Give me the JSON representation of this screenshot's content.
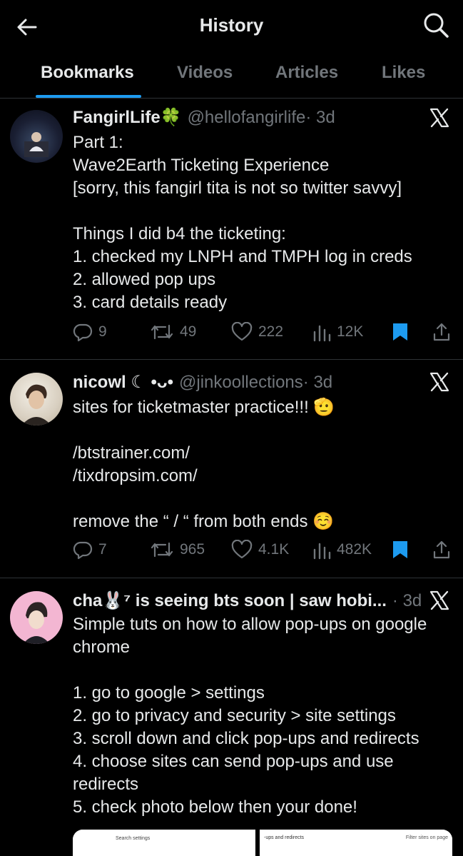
{
  "header": {
    "title": "History"
  },
  "tabs": [
    {
      "label": "Bookmarks",
      "active": true
    },
    {
      "label": "Videos",
      "active": false
    },
    {
      "label": "Articles",
      "active": false
    },
    {
      "label": "Likes",
      "active": false
    }
  ],
  "tweets": [
    {
      "name": "FangirlLife🍀",
      "handle": "@hellofangirlife",
      "time": "· 3d",
      "text": "Part 1:\nWave2Earth Ticketing Experience\n[sorry, this fangirl tita is not so twitter savvy]\n\nThings I did b4 the ticketing:\n1. checked my LNPH and TMPH log in creds\n2. allowed pop ups\n3. card details ready",
      "replies": "9",
      "reposts": "49",
      "likes": "222",
      "views": "12K"
    },
    {
      "name": "nicowl ☾ •ᴗ•",
      "handle": "@jinkoollections",
      "time": "· 3d",
      "text": "sites for ticketmaster practice!!! 🫡\n\n/btstrainer.com/\n/tixdropsim.com/\n\nremove the “ / “ from both ends ☺️",
      "replies": "7",
      "reposts": "965",
      "likes": "4.1K",
      "views": "482K"
    },
    {
      "name": "cha🐰⁷ is seeing bts soon | saw hobi...",
      "handle": "",
      "time": "· 3d",
      "text": "Simple tuts on how to allow pop-ups on google chrome\n\n1. go to google > settings\n2. go to privacy and security > site settings\n3. scroll down and click pop-ups and redirects\n4. choose sites can send pop-ups and use redirects\n5. check photo below then your done!",
      "media_text_left": "Search settings",
      "media_text_mid": "-ups and redirects",
      "media_text_right": "Filter sites on page"
    }
  ]
}
